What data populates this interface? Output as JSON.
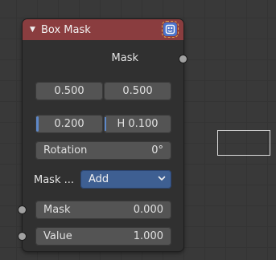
{
  "node": {
    "title": "Box Mask",
    "output_label": "Mask",
    "x_value": "0.500",
    "y_value": "0.500",
    "width_value": "0.200",
    "height_value": "H 0.100",
    "rotation_label": "Rotation",
    "rotation_value": "0°",
    "mask_type_label": "Mask ...",
    "mask_type_value": "Add",
    "mask_input_label": "Mask",
    "mask_input_value": "0.000",
    "value_input_label": "Value",
    "value_input_value": "1.000"
  },
  "colors": {
    "header": "#8a3d3f",
    "accent_blue": "#5e88c8",
    "select_blue": "#3e5f92",
    "socket_gray": "#a1a1a1"
  },
  "icons": {
    "collapse": "triangle-down",
    "badge": "mask-icon",
    "dropdown": "chevron-down"
  }
}
